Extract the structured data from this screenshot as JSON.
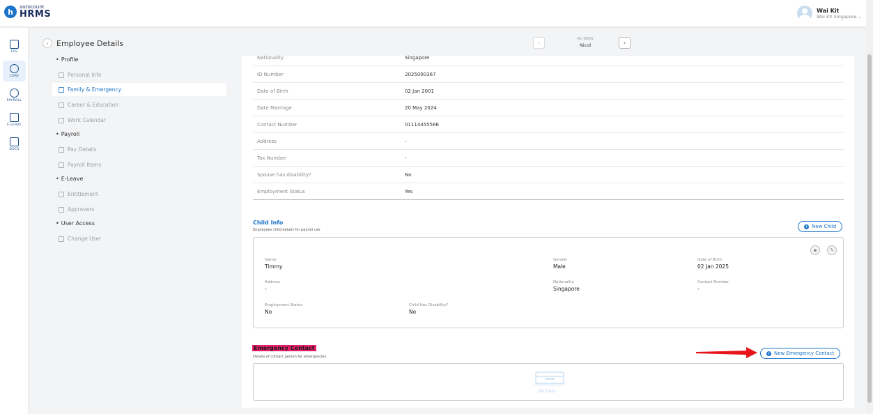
{
  "app": {
    "logo_small": "autocount",
    "logo_big": "HRMS",
    "logo_letter": "h"
  },
  "user": {
    "name": "Wai Kit",
    "company": "Wai Kit Singapore ⌄"
  },
  "rail": {
    "items": [
      {
        "label": "ESS",
        "icon": "ess-icon"
      },
      {
        "label": "CORE",
        "icon": "core-icon"
      },
      {
        "label": "PAYROLL",
        "icon": "payroll-icon"
      },
      {
        "label": "E-LEAVE",
        "icon": "calendar-icon"
      },
      {
        "label": "DOCS",
        "icon": "docs-icon"
      }
    ]
  },
  "header": {
    "title": "Employee Details",
    "employee_code": "AC-0001",
    "employee_name": "Nicol",
    "back": "‹",
    "prev": "‹",
    "next": "›"
  },
  "menu": {
    "profile": "Profile",
    "personal_info": "Personal Info",
    "family_emergency": "Family & Emergency",
    "career_education": "Career & Education",
    "work_calendar": "Work Calendar",
    "payroll": "Payroll",
    "pay_details": "Pay Details",
    "payroll_items": "Payroll Items",
    "eleave": "E-Leave",
    "entitlement": "Entitlement",
    "approvers": "Approvers",
    "user_access": "User Access",
    "change_user": "Change User"
  },
  "spouse": {
    "rows": [
      {
        "key": "Nationality",
        "value": "Singapore"
      },
      {
        "key": "ID Number",
        "value": "2025000367"
      },
      {
        "key": "Date of Birth",
        "value": "02 Jan 2001"
      },
      {
        "key": "Date Marriage",
        "value": "20 May 2024"
      },
      {
        "key": "Contact Number",
        "value": "01114455566"
      },
      {
        "key": "Address",
        "value": "-"
      },
      {
        "key": "Tax Number",
        "value": "-"
      },
      {
        "key": "Spouse has disability?",
        "value": "No"
      },
      {
        "key": "Employment Status",
        "value": "Yes"
      }
    ]
  },
  "child": {
    "title": "Child Info",
    "subtitle": "Employees child details for payroll use",
    "new_button": "New Child",
    "name_label": "Name",
    "name": "Timmy",
    "gender_label": "Gender",
    "gender": "Male",
    "dob_label": "Date of Birth",
    "dob": "02 Jan 2025",
    "address_label": "Address",
    "address": "-",
    "nationality_label": "Nationality",
    "nationality": "Singapore",
    "contact_label": "Contact Number",
    "contact": "-",
    "employment_label": "Employment Status",
    "employment": "No",
    "disability_label": "Child Has Disability?",
    "disability": "No"
  },
  "emergency": {
    "title": "Emergency Contact",
    "subtitle": "Details of contact person for emergencies",
    "new_button": "New Emergency Contact",
    "empty_text": "No Data"
  },
  "colors": {
    "accent": "#1a73c9",
    "highlight": "#e8206a",
    "arrow": "#e8141c"
  }
}
